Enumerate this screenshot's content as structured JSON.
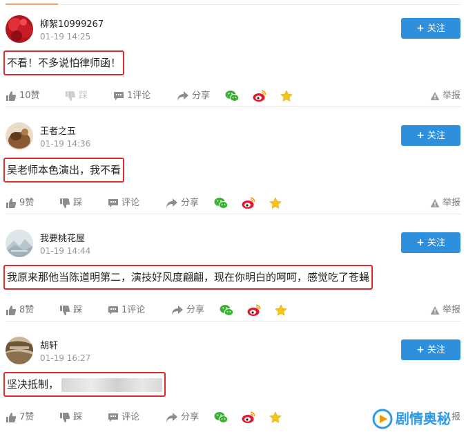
{
  "comments": [
    {
      "username": "柳絮10999267",
      "time": "01-19 14:25",
      "follow_label": "关注",
      "text": "不看！不多说怕律师函！",
      "likes": "10赞",
      "dislike_label": "踩",
      "comment_count": "1评论",
      "share_label": "分享",
      "report_label": "举报"
    },
    {
      "username": "王者之五",
      "time": "01-19 14:36",
      "follow_label": "关注",
      "text": "吴老师本色演出，我不看",
      "likes": "9赞",
      "dislike_label": "踩",
      "comment_count": "评论",
      "share_label": "分享",
      "report_label": "举报"
    },
    {
      "username": "我要桃花屋",
      "time": "01-19 14:44",
      "follow_label": "关注",
      "text": "我原来那他当陈道明第二，演技好风度翩翩，现在你明白的呵呵，感觉吃了苍蝇",
      "likes": "8赞",
      "dislike_label": "踩",
      "comment_count": "1评论",
      "share_label": "分享",
      "report_label": "举报"
    },
    {
      "username": "胡轩",
      "time": "01-19 16:27",
      "follow_label": "关注",
      "text": "坚决抵制，",
      "likes": "7赞",
      "dislike_label": "踩",
      "comment_count": "评论",
      "share_label": "分享",
      "report_label": "报"
    }
  ],
  "icons": {
    "like": "thumbs-up-icon",
    "dislike": "thumbs-down-icon",
    "comment": "chat-bubble-icon",
    "share": "share-arrow-icon",
    "wechat": "wechat-icon",
    "weibo": "weibo-icon",
    "favorite": "star-icon",
    "report": "warning-icon"
  },
  "colors": {
    "follow_button": "#2e8fdc",
    "highlight_box": "#e02a2a",
    "wechat": "#3cb034",
    "weibo": "#e6162d",
    "star": "#f5c518",
    "watermark": "#2f9be6"
  },
  "watermark": {
    "text": "剧情奥秘"
  }
}
